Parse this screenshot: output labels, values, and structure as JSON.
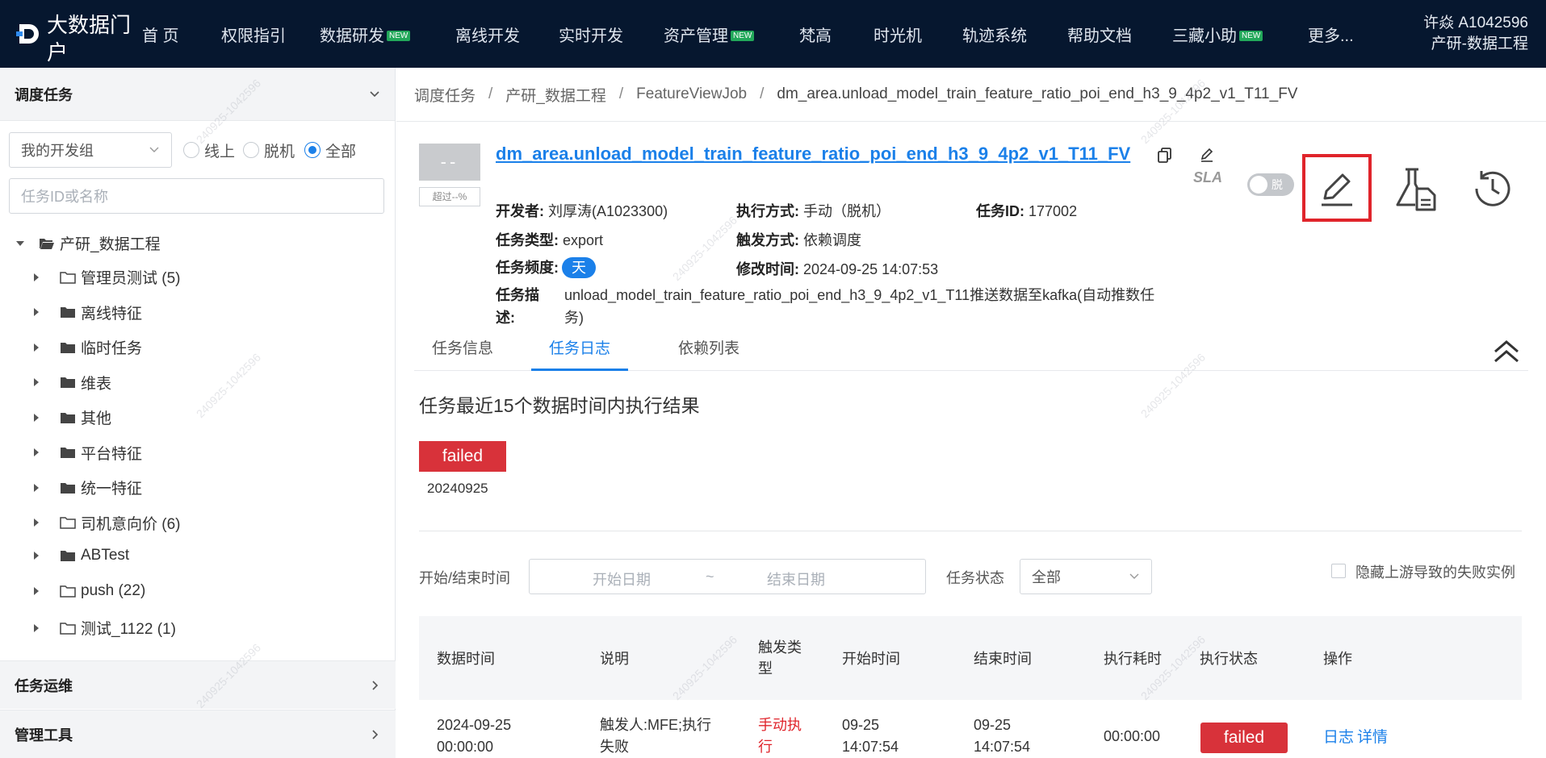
{
  "app": {
    "logo_text": "大数据门户",
    "nav": [
      {
        "label": "首 页",
        "badge": ""
      },
      {
        "label": "权限指引",
        "badge": ""
      },
      {
        "label": "数据研发",
        "badge": "NEW"
      },
      {
        "label": "离线开发",
        "badge": ""
      },
      {
        "label": "实时开发",
        "badge": ""
      },
      {
        "label": "资产管理",
        "badge": "NEW"
      },
      {
        "label": "梵高",
        "badge": ""
      },
      {
        "label": "时光机",
        "badge": ""
      },
      {
        "label": "轨迹系统",
        "badge": ""
      },
      {
        "label": "帮助文档",
        "badge": ""
      },
      {
        "label": "三藏小助",
        "badge": "NEW"
      },
      {
        "label": "更多...",
        "badge": ""
      }
    ],
    "user": {
      "name": "许焱 A1042596",
      "dept": "产研-数据工程"
    },
    "colors": {
      "nav_bg": "#06172f",
      "accent": "#1b80e9",
      "danger": "#d8323a",
      "new_badge": "#22a85a"
    }
  },
  "sidebar": {
    "header": "调度任务",
    "group_select": "我的开发组",
    "radios": [
      {
        "label": "线上",
        "checked": false
      },
      {
        "label": "脱机",
        "checked": false
      },
      {
        "label": "全部",
        "checked": true
      }
    ],
    "search_placeholder": "任务ID或名称",
    "tree_root": "产研_数据工程",
    "tree": [
      {
        "label": "管理员测试 (5)",
        "icon": "folder-outline-icon"
      },
      {
        "label": "离线特征",
        "icon": "folder-filled-icon"
      },
      {
        "label": "临时任务",
        "icon": "folder-filled-icon"
      },
      {
        "label": "维表",
        "icon": "folder-filled-icon"
      },
      {
        "label": "其他",
        "icon": "folder-filled-icon"
      },
      {
        "label": "平台特征",
        "icon": "folder-filled-icon"
      },
      {
        "label": "统一特征",
        "icon": "folder-filled-icon"
      },
      {
        "label": "司机意向价 (6)",
        "icon": "folder-outline-icon"
      },
      {
        "label": "ABTest",
        "icon": "folder-filled-icon"
      },
      {
        "label": "push (22)",
        "icon": "folder-outline-icon"
      },
      {
        "label": "测试_1122 (1)",
        "icon": "folder-outline-icon"
      }
    ],
    "sections": [
      "任务运维",
      "管理工具"
    ]
  },
  "breadcrumb": [
    "调度任务",
    "产研_数据工程",
    "FeatureViewJob",
    "dm_area.unload_model_train_feature_ratio_poi_end_h3_9_4p2_v1_T11_FV"
  ],
  "job": {
    "sla_box": "--",
    "sla_sub": "超过--%",
    "title": "dm_area.unload_model_train_feature_ratio_poi_end_h3_9_4p2_v1_T11_FV",
    "sla_label": "SLA",
    "toggle_label": "脱",
    "developer_k": "开发者:",
    "developer_v": "刘厚涛(A1023300)",
    "exec_k": "执行方式:",
    "exec_v": "手动（脱机）",
    "id_k": "任务ID:",
    "id_v": "177002",
    "type_k": "任务类型:",
    "type_v": "export",
    "trigger_k": "触发方式:",
    "trigger_v": "依赖调度",
    "freq_k": "任务频度:",
    "freq_v": "天",
    "modified_k": "修改时间:",
    "modified_v": "2024-09-25 14:07:53",
    "desc_k": "任务描述:",
    "desc_v": "unload_model_train_feature_ratio_poi_end_h3_9_4p2_v1_T11推送数据至kafka(自动推数任务)"
  },
  "tabs": [
    "任务信息",
    "任务日志",
    "依赖列表"
  ],
  "log": {
    "title": "任务最近15个数据时间内执行结果",
    "recent_status": "failed",
    "recent_date": "20240925",
    "filter_time_label": "开始/结束时间",
    "start_placeholder": "开始日期",
    "range_sep": "~",
    "end_placeholder": "结束日期",
    "status_label": "任务状态",
    "status_value": "全部",
    "hide_label": "隐藏上游导致的失败实例",
    "columns": [
      "数据时间",
      "说明",
      "触发类型",
      "开始时间",
      "结束时间",
      "执行耗时",
      "执行状态",
      "操作"
    ],
    "rows": [
      {
        "data_time": "2024-09-25 00:00:00",
        "note": "触发人:MFE;执行失败",
        "trigger": "手动执行",
        "start": "09-25 14:07:54",
        "end": "09-25 14:07:54",
        "duration": "00:00:00",
        "status": "failed",
        "actions": [
          "日志",
          "详情"
        ]
      }
    ]
  },
  "watermark": "240925-1042596"
}
